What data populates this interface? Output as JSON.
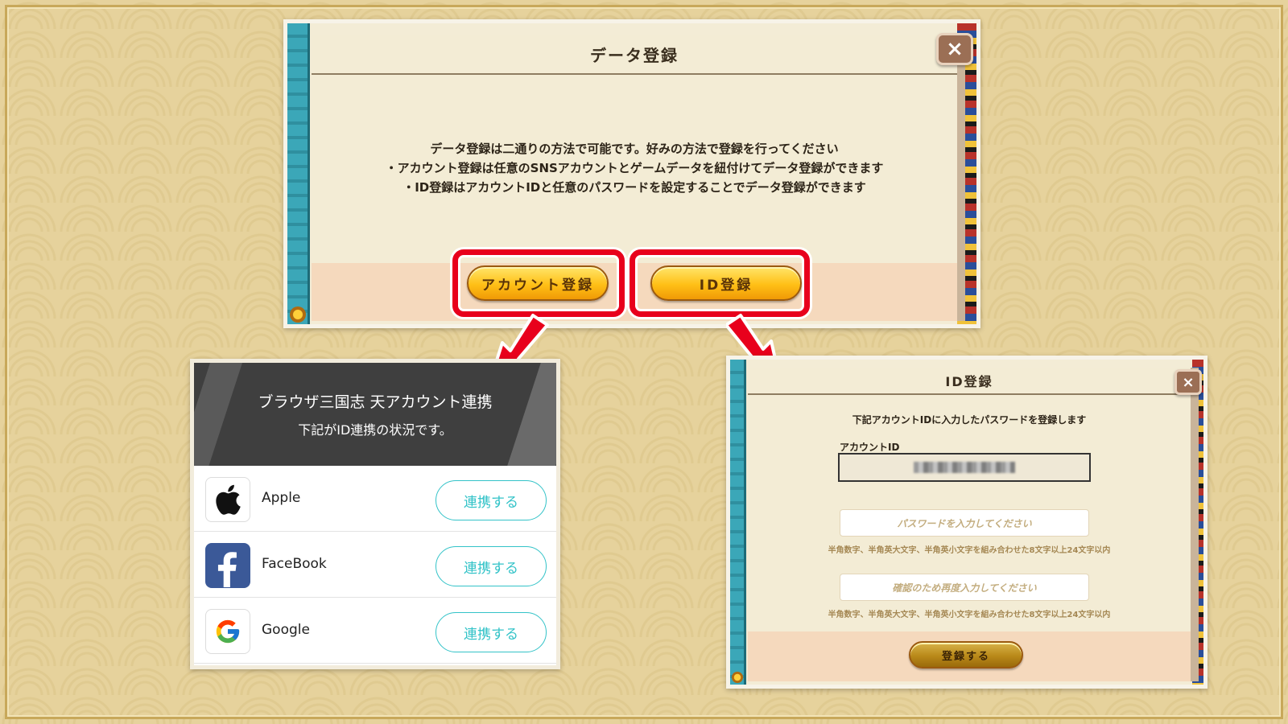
{
  "data_dialog": {
    "title": "データ登録",
    "close_label": "×",
    "description": [
      "データ登録は二通りの方法で可能です。好みの方法で登録を行ってください",
      "・アカウント登録は任意のSNSアカウントとゲームデータを紐付けてデータ登録ができます",
      "・ID登録はアカウントIDと任意のパスワードを設定することでデータ登録ができます"
    ],
    "account_button": "アカウント登録",
    "id_button": "ID登録"
  },
  "account_panel": {
    "title": "ブラウザ三国志 天アカウント連携",
    "subtitle": "下記がID連携の状況です。",
    "providers": [
      {
        "name": "Apple",
        "icon": "apple-icon",
        "button": "連携する"
      },
      {
        "name": "FaceBook",
        "icon": "facebook-icon",
        "button": "連携する"
      },
      {
        "name": "Google",
        "icon": "google-icon",
        "button": "連携する"
      }
    ]
  },
  "id_dialog": {
    "title": "ID登録",
    "close_label": "×",
    "instruction": "下記アカウントIDに入力したパスワードを登録します",
    "account_id_label": "アカウントID",
    "password_placeholder": "パスワードを入力してください",
    "password_hint": "半角数字、半角英大文字、半角英小文字を組み合わせた8文字以上24文字以内",
    "confirm_placeholder": "確認のため再度入力してください",
    "confirm_hint": "半角数字、半角英大文字、半角英小文字を組み合わせた8文字以上24文字以内",
    "submit_button": "登録する"
  },
  "colors": {
    "highlight": "#e8001c",
    "link_accent": "#33c3c8",
    "gold_button": "#ffbf16"
  }
}
